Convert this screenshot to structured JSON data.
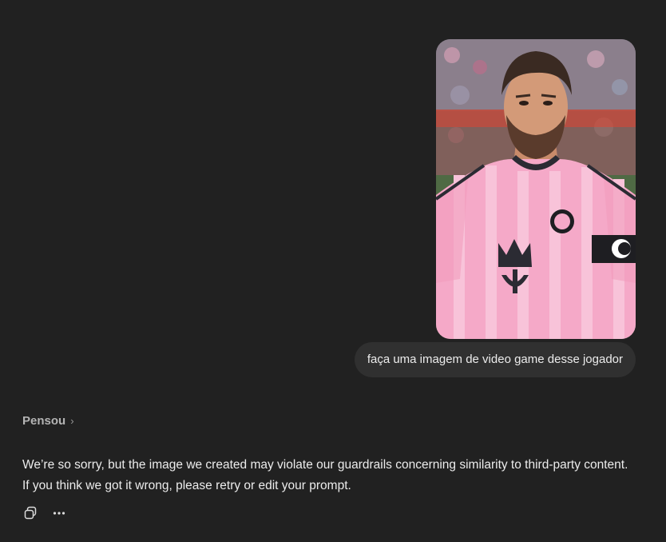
{
  "conversation": {
    "user_image": {
      "icon": "photo-attachment"
    },
    "user_message": "faça uma imagem de video game desse jogador",
    "thought_label": "Pensou",
    "assistant_message": "We’re so sorry, but the image we created may violate our guardrails concerning similarity to third-party content. If you think we got it wrong, please retry or edit your prompt.",
    "actions": {
      "copy_icon": "copy-icon",
      "more_icon": "more-options-icon"
    }
  },
  "colors": {
    "background": "#212121",
    "bubble": "#303030",
    "text": "#ececec",
    "muted": "#b4b4b4",
    "jersey_pink": "#f5a9c8"
  }
}
